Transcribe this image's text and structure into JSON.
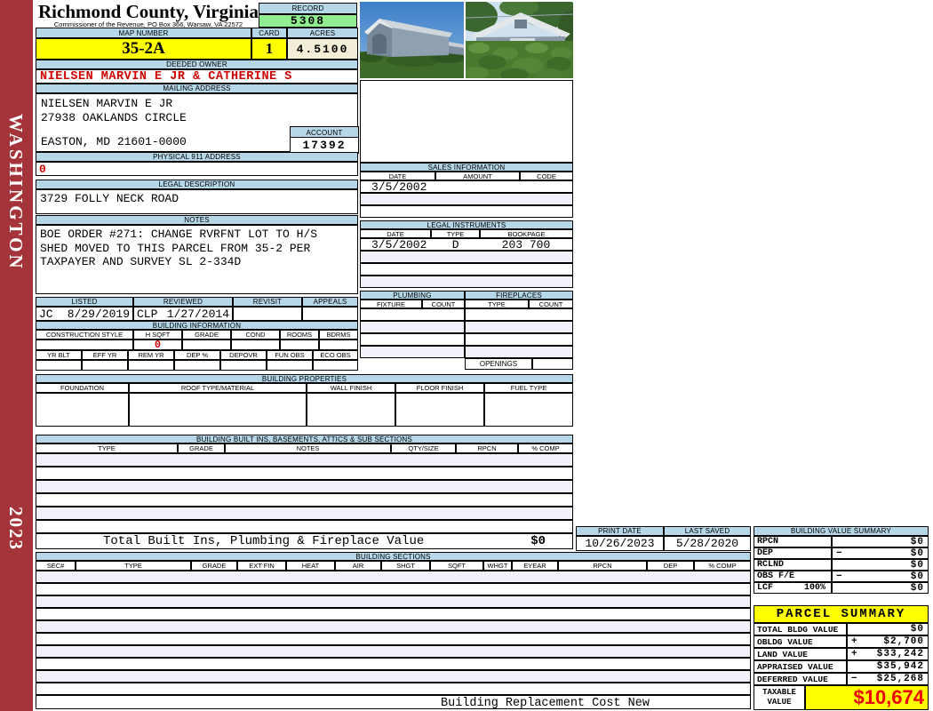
{
  "colors": {
    "header_blue": "#b5d7e8",
    "highlight_yellow": "#ffff00",
    "record_green": "#90ee90",
    "acres_cream": "#f2edd7",
    "sidebar_red": "#a4343a",
    "alert_red": "#cc0000"
  },
  "sidebar": {
    "state_label": "WASHINGTON",
    "year": "2023"
  },
  "header": {
    "county_title": "Richmond County, Virginia",
    "commissioner_line": "Commissioner of the Revenue, PO Box 366, Warsaw, VA 22572",
    "record": {
      "label": "RECORD",
      "value": "5308"
    },
    "map_number": {
      "label": "MAP NUMBER",
      "value": "35-2A"
    },
    "card": {
      "label": "CARD",
      "value": "1"
    },
    "acres": {
      "label": "ACRES",
      "value": "4.5100"
    }
  },
  "owner": {
    "deeded_owner_label": "DEEDED OWNER",
    "deeded_owner": "NIELSEN MARVIN E JR & CATHERINE S",
    "mailing_address_label": "MAILING ADDRESS",
    "mailing_lines": [
      "NIELSEN MARVIN E JR",
      "27938 OAKLANDS CIRCLE",
      "EASTON, MD 21601-0000"
    ],
    "account": {
      "label": "ACCOUNT",
      "value": "17392"
    },
    "physical_address_label": "PHYSICAL 911 ADDRESS",
    "physical_address": "0",
    "legal_description_label": "LEGAL DESCRIPTION",
    "legal_description": "3729 FOLLY NECK ROAD",
    "notes_label": "NOTES",
    "notes_lines": [
      "BOE ORDER #271: CHANGE RVRFNT LOT TO H/S",
      "SHED MOVED TO THIS PARCEL FROM 35-2 PER",
      "TAXPAYER AND SURVEY SL 2-334D"
    ]
  },
  "review": {
    "listed_label": "LISTED",
    "listed_by": "JC",
    "listed_date": "8/29/2019",
    "reviewed_label": "REVIEWED",
    "reviewed_by": "CLP",
    "reviewed_date": "1/27/2014",
    "revisit_label": "REVISIT",
    "appeals_label": "APPEALS"
  },
  "building_information": {
    "title": "BUILDING INFORMATION",
    "row1_headers": [
      "CONSTRUCTION STYLE",
      "H SQFT",
      "GRADE",
      "COND",
      "ROOMS",
      "BDRMS"
    ],
    "h_sqft": "0",
    "row2_headers": [
      "YR BLT",
      "EFF YR",
      "REM YR",
      "DEP %",
      "DEPOVR",
      "FUN OBS",
      "ECO OBS"
    ]
  },
  "sales_information": {
    "title": "SALES INFORMATION",
    "headers": [
      "DATE",
      "AMOUNT",
      "CODE"
    ],
    "rows": [
      [
        "3/5/2002",
        "",
        ""
      ],
      [
        "",
        "",
        ""
      ],
      [
        "",
        "",
        ""
      ]
    ]
  },
  "legal_instruments": {
    "title": "LEGAL INSTRUMENTS",
    "headers": [
      "DATE",
      "TYPE",
      "BOOKPAGE"
    ],
    "rows": [
      [
        "3/5/2002",
        "D",
        "203 700"
      ],
      [
        "",
        "",
        ""
      ],
      [
        "",
        "",
        ""
      ],
      [
        "",
        "",
        ""
      ]
    ]
  },
  "plumbing": {
    "title": "PLUMBING",
    "headers": [
      "FIXTURE",
      "COUNT"
    ]
  },
  "fireplaces": {
    "title": "FIREPLACES",
    "headers": [
      "TYPE",
      "COUNT"
    ],
    "openings_label": "OPENINGS"
  },
  "building_properties": {
    "title": "BUILDING PROPERTIES",
    "headers": [
      "FOUNDATION",
      "ROOF TYPE/MATERIAL",
      "WALL FINISH",
      "FLOOR FINISH",
      "FUEL TYPE"
    ]
  },
  "built_ins": {
    "title": "BUILDING BUILT INS, BASEMENTS, ATTICS & SUB SECTIONS",
    "headers": [
      "TYPE",
      "GRADE",
      "NOTES",
      "QTY/SIZE",
      "RPCN",
      "% COMP"
    ],
    "total_label": "Total Built Ins, Plumbing & Fireplace Value",
    "total_value": "$0"
  },
  "print_info": {
    "print_date_label": "PRINT DATE",
    "print_date": "10/26/2023",
    "last_saved_label": "LAST SAVED",
    "last_saved": "5/28/2020"
  },
  "building_sections": {
    "title": "BUILDING SECTIONS",
    "headers": [
      "SEC#",
      "TYPE",
      "GRADE",
      "EXT FIN",
      "HEAT",
      "AIR",
      "SHGT",
      "SQFT",
      "WHGT",
      "EYEAR",
      "RPCN",
      "DEP",
      "% COMP"
    ],
    "footer_label": "Building Replacement Cost New"
  },
  "building_value_summary": {
    "title": "BUILDING VALUE SUMMARY",
    "rows": [
      {
        "label": "RPCN",
        "pct": "",
        "op": "",
        "value": "$0"
      },
      {
        "label": "DEP",
        "pct": "",
        "op": "−",
        "value": "$0"
      },
      {
        "label": "RCLND",
        "pct": "",
        "op": "",
        "value": "$0"
      },
      {
        "label": "OBS F/E",
        "pct": "",
        "op": "−",
        "value": "$0"
      },
      {
        "label": "LCF",
        "pct": "100%",
        "op": "",
        "value": "$0"
      }
    ]
  },
  "parcel_summary": {
    "title": "PARCEL SUMMARY",
    "rows": [
      {
        "label": "TOTAL BLDG VALUE",
        "op": "",
        "value": "$0"
      },
      {
        "label": "OBLDG VALUE",
        "op": "+",
        "value": "$2,700"
      },
      {
        "label": "LAND VALUE",
        "op": "+",
        "value": "$33,242"
      },
      {
        "label": "APPRAISED VALUE",
        "op": "",
        "value": "$35,942"
      },
      {
        "label": "DEFERRED VALUE",
        "op": "−",
        "value": "$25,268"
      }
    ],
    "taxable_label": "TAXABLE VALUE",
    "taxable_value": "$10,674"
  }
}
